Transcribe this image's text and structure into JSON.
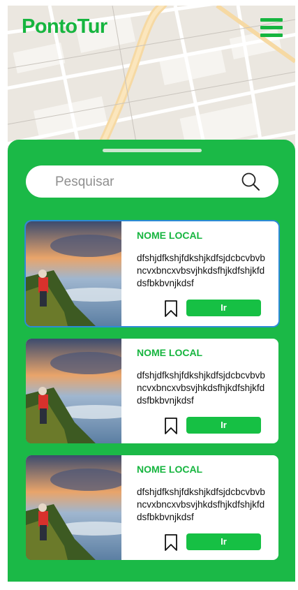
{
  "app": {
    "title": "PontoTur"
  },
  "header": {
    "menu_icon": "hamburger-menu-icon"
  },
  "search": {
    "placeholder": "Pesquisar",
    "icon": "search-icon"
  },
  "colors": {
    "brand_green": "#16b53f",
    "sheet_green": "#1bb947",
    "button_green": "#16c044",
    "selected_border": "#2d8bd6"
  },
  "places": [
    {
      "name": "NOME LOCAL",
      "description": "dfshjdfkshjfdkshjkdfsjdcbcvbvbncvxbncxvbsvjhkdsfhjkdfshjkfddsfbkbvnjkdsf",
      "button_label": "Ir",
      "selected": true
    },
    {
      "name": "NOME LOCAL",
      "description": "dfshjdfkshjfdkshjkdfsjdcbcvbvbncvxbncxvbsvjhkdsfhjkdfshjkfddsfbkbvnjkdsf",
      "button_label": "Ir",
      "selected": false
    },
    {
      "name": "NOME LOCAL",
      "description": "dfshjdfkshjfdkshjkdfsjdcbcvbvbncvxbncxvbsvjhkdsfhjkdfshjkfddsfbkbvnjkdsf",
      "button_label": "Ir",
      "selected": false
    }
  ]
}
